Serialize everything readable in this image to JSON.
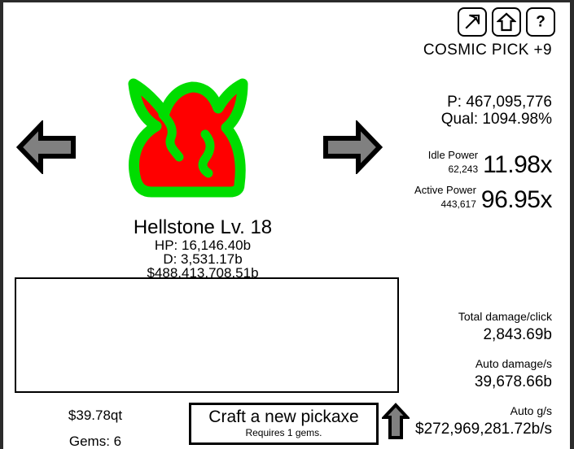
{
  "colors": {
    "sprite_fill": "#ff0000",
    "sprite_outline": "#00dd00",
    "arrow_fill": "#808080",
    "arrow_outline": "#000000",
    "frame": "#2b2b2b",
    "background": "#ffffff",
    "text": "#000000"
  },
  "toolbar": {
    "pickaxe_icon": "pickaxe-icon",
    "upgrade_icon": "upgrade-arrow-icon",
    "help_icon": "question-mark-icon"
  },
  "pickaxe": {
    "title": "COSMIC PICK +9",
    "power_line": "P: 467,095,776",
    "quality_line": "Qual: 1094.98%"
  },
  "power": {
    "idle": {
      "label": "Idle Power",
      "value": "62,243",
      "multiplier": "11.98x"
    },
    "active": {
      "label": "Active Power",
      "value": "443,617",
      "multiplier": "96.95x"
    }
  },
  "stats": [
    {
      "label": "Total damage/click",
      "value": "2,843.69b"
    },
    {
      "label": "Auto damage/s",
      "value": "39,678.66b"
    },
    {
      "label": "Auto g/s",
      "value": "$272,969,281.72b/s"
    }
  ],
  "monster": {
    "name": "Hellstone Lv. 18",
    "hp": "HP: 16,146.40b",
    "damage": "D: 3,531.17b",
    "gold": "$488,413,708.51b",
    "sprite_name": "hellstone-horned-head-sprite"
  },
  "navigation": {
    "previous_icon": "arrow-left-icon",
    "next_icon": "arrow-right-icon"
  },
  "log": {
    "text": ""
  },
  "currency": {
    "money": "$39.78qt",
    "gems": "Gems: 6"
  },
  "craft": {
    "label": "Craft a new pickaxe",
    "requirement": "Requires 1 gems.",
    "upgrade_icon": "up-arrow-icon"
  }
}
